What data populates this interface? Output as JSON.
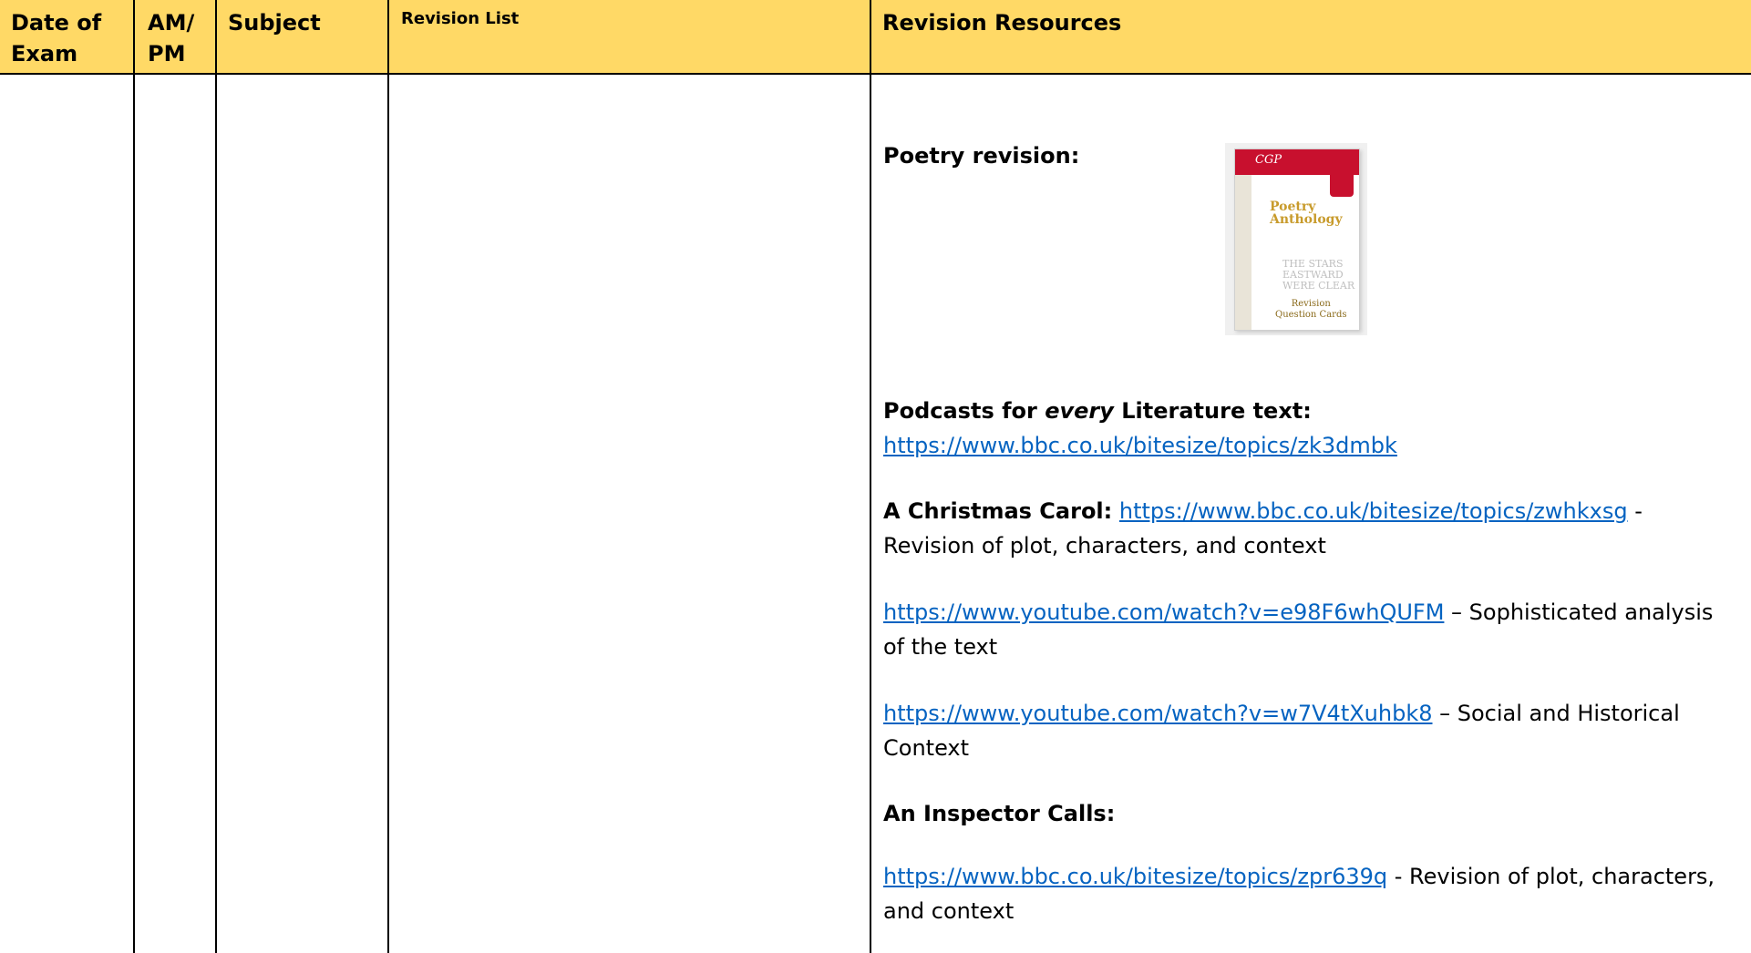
{
  "header": {
    "date_of_exam": "Date of Exam",
    "am_pm": "AM/ PM",
    "subject": "Subject",
    "revision_list": "Revision List",
    "revision_resources": "Revision Resources"
  },
  "resources": {
    "poetry_label": "Poetry revision:",
    "book_cover": {
      "publisher": "CGP",
      "title_line1": "Poetry",
      "title_line2": "Anthology",
      "tagline": "THE STARS EASTWARD WERE CLEAR",
      "label_line1": "Revision",
      "label_line2": "Question Cards"
    },
    "podcasts_pre": "Podcasts for ",
    "podcasts_em": "every",
    "podcasts_post": " Literature text:",
    "podcasts_link": "https://www.bbc.co.uk/bitesize/topics/zk3dmbk",
    "acc_label": "A Christmas Carol:",
    "acc_link": "https://www.bbc.co.uk/bitesize/topics/zwhkxsg",
    "acc_desc": " - Revision of plot, characters, and context",
    "yt1_link": "https://www.youtube.com/watch?v=e98F6whQUFM",
    "yt1_desc": " – Sophisticated analysis of the text",
    "yt2_link": "https://www.youtube.com/watch?v=w7V4tXuhbk8",
    "yt2_desc": " – Social and Historical Context",
    "aic_label": "An Inspector Calls:",
    "aic_link": "https://www.bbc.co.uk/bitesize/topics/zpr639q",
    "aic_desc": " - Revision of plot, characters, and context"
  }
}
